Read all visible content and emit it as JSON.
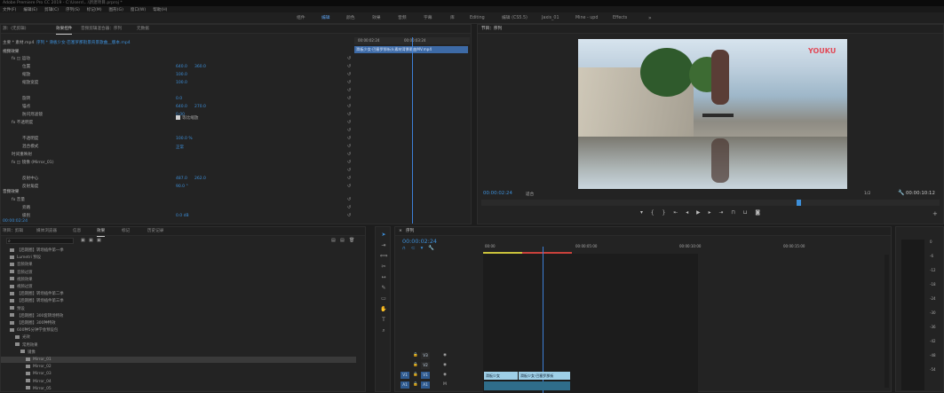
{
  "window_title": "Adobe Premiere Pro CC 2019 - C:\\Users\\...\\新建项目.prproj *",
  "menu": [
    "文件(F)",
    "编辑(E)",
    "剪辑(C)",
    "序列(S)",
    "标记(M)",
    "图形(G)",
    "窗口(W)",
    "帮助(H)"
  ],
  "workspaces": [
    "组件",
    "编辑",
    "颜色",
    "效果",
    "音频",
    "字幕",
    "库",
    "Editing",
    "编辑 (CS5.5)",
    "Jaxis_01",
    "Mine - upd",
    "Effects",
    "»"
  ],
  "effect_controls": {
    "tabs": [
      "源：(无剪辑)",
      "效果控件",
      "音频剪辑混合器：序列",
      "元数据"
    ],
    "clip_path": "主要 * 素材.mp4",
    "clip_header": "序列 * 滑板少女·巴塞罗那街景背景歌曲__版本.mp4",
    "timeline_ruler_start": "00:00:02:24",
    "timeline_ruler_mid": "00:00:03:24",
    "clip_bar": "滑板少女·巴塞罗那街头素材背景歌曲MV.mp4",
    "section_video": "视频效果",
    "rows": [
      {
        "label": "fx  ◫  运动",
        "indent": 1,
        "v1": "",
        "v2": ""
      },
      {
        "label": "位置",
        "indent": 3,
        "v1": "640.0",
        "v2": "360.0"
      },
      {
        "label": "缩放",
        "indent": 3,
        "v1": "100.0",
        "v2": ""
      },
      {
        "label": "缩放宽度",
        "indent": 3,
        "v1": "100.0",
        "v2": ""
      },
      {
        "label": "",
        "indent": 3,
        "v1": "",
        "v2": ""
      },
      {
        "label": "旋转",
        "indent": 3,
        "v1": "0.0",
        "v2": ""
      },
      {
        "label": "锚点",
        "indent": 3,
        "v1": "640.0",
        "v2": "270.0"
      },
      {
        "label": "防闪烁滤镜",
        "indent": 3,
        "v1": "0.00",
        "v2": ""
      },
      {
        "label": "fx  不透明度",
        "indent": 1,
        "v1": "",
        "v2": ""
      },
      {
        "label": "",
        "indent": 3,
        "v1": "",
        "v2": ""
      },
      {
        "label": "不透明度",
        "indent": 3,
        "v1": "100.0 %",
        "v2": ""
      },
      {
        "label": "混合模式",
        "indent": 3,
        "v1": "正常",
        "v2": ""
      },
      {
        "label": "时间重映射",
        "indent": 1,
        "v1": "",
        "v2": ""
      },
      {
        "label": "fx  ◫  镜像 (Mirror_01)",
        "indent": 1,
        "v1": "",
        "v2": ""
      },
      {
        "label": "",
        "indent": 3,
        "v1": "",
        "v2": ""
      },
      {
        "label": "反射中心",
        "indent": 3,
        "v1": "487.0",
        "v2": "262.0"
      },
      {
        "label": "反射角度",
        "indent": 3,
        "v1": "90.0 °",
        "v2": ""
      }
    ],
    "uniform_scale": "等比缩放",
    "section_audio": "音频效果",
    "audio_rows": [
      {
        "label": "fx  音量",
        "indent": 1,
        "v1": ""
      },
      {
        "label": "旁路",
        "indent": 3,
        "v1": ""
      },
      {
        "label": "级别",
        "indent": 3,
        "v1": "0.0 dB"
      }
    ],
    "time": "00:00:02:24"
  },
  "program": {
    "title": "节目：序列",
    "watermark": "YOUKU",
    "timecode": "00:00:02:24",
    "fit": "适合",
    "res": "1/2",
    "duration": "00:00:10:12"
  },
  "project": {
    "tabs": [
      "项目：剪辑",
      "媒体浏览器",
      "信息",
      "效果",
      "标记",
      "历史记录"
    ],
    "items": [
      {
        "label": "【后期圈】转场插件第一季",
        "indent": 1
      },
      {
        "label": "Lumetri 预设",
        "indent": 1
      },
      {
        "label": "音频效果",
        "indent": 1
      },
      {
        "label": "音频过渡",
        "indent": 1
      },
      {
        "label": "视频效果",
        "indent": 1
      },
      {
        "label": "视频过渡",
        "indent": 1
      },
      {
        "label": "【后期圈】转场插件第二季",
        "indent": 1
      },
      {
        "label": "【后期圈】转场插件第三季",
        "indent": 1
      },
      {
        "label": "预设",
        "indent": 1
      },
      {
        "label": "【后期圈】300套转场特效",
        "indent": 1
      },
      {
        "label": "【后期圈】300种特效",
        "indent": 1
      },
      {
        "label": "600种5分钟学会预设包",
        "indent": 1
      },
      {
        "label": "光效",
        "indent": 2
      },
      {
        "label": "常用效果",
        "indent": 2
      },
      {
        "label": "镜像",
        "indent": 3
      },
      {
        "label": "Mirror_01",
        "indent": 4
      },
      {
        "label": "Mirror_02",
        "indent": 4
      },
      {
        "label": "Mirror_03",
        "indent": 4
      },
      {
        "label": "Mirror_04",
        "indent": 4
      },
      {
        "label": "Mirror_05",
        "indent": 4
      }
    ]
  },
  "timeline": {
    "title": "序列",
    "timecode": "00:00:02:24",
    "ruler": [
      "00:00",
      "00:00:05:00",
      "00:00:10:00",
      "00:00:15:00"
    ],
    "tracks": [
      {
        "lock": "🔒",
        "name": "V3",
        "v": ""
      },
      {
        "lock": "🔒",
        "name": "V2",
        "v": ""
      },
      {
        "lock": "🔒",
        "name": "V1",
        "v": "V1"
      },
      {
        "lock": "🔒",
        "name": "A1",
        "v": "A1"
      }
    ],
    "clip_v1a": "滑板少女",
    "clip_v1b": "滑板少女·巴塞罗那街"
  },
  "meter_labels": [
    "0",
    "-6",
    "-12",
    "-18",
    "-24",
    "-30",
    "-36",
    "-42",
    "-48",
    "-54"
  ],
  "icons": [
    "selection-tool-icon",
    "track-select-icon",
    "ripple-edit-icon",
    "razor-icon",
    "slip-icon",
    "pen-icon",
    "hand-icon",
    "zoom-icon",
    "play-icon",
    "wrench-icon"
  ]
}
